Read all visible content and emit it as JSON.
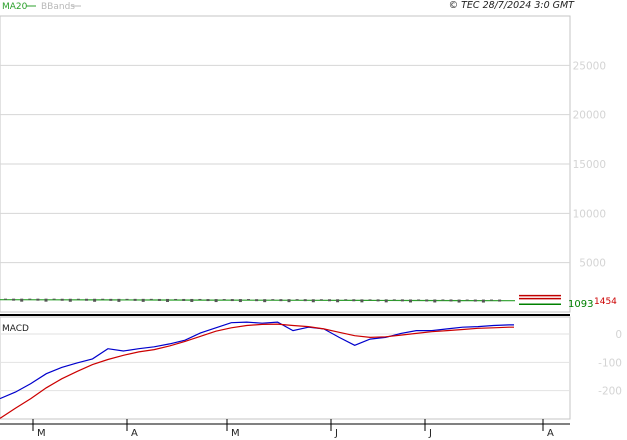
{
  "legend": {
    "ma_label": "MA20",
    "bbands_label": "BBands",
    "ma_color": "#2ca02c",
    "bbands_color": "#b8b8b8"
  },
  "copyright": "© TEC 28/7/2024 3:0 GMT",
  "macd_label": "MACD",
  "price_value_label": "1093",
  "price_value_label2": "1454",
  "chart_data": [
    {
      "type": "line",
      "title": "",
      "yticks": [
        "5000",
        "10000",
        "15000",
        "20000",
        "25000"
      ],
      "ylim": [
        0,
        30000
      ],
      "grid": true,
      "series": [
        {
          "name": "MA20",
          "color": "#2ca02c",
          "x": [
            0,
            10,
            20,
            30,
            40,
            50,
            60,
            70,
            80,
            90,
            100
          ],
          "values": [
            1250,
            1240,
            1230,
            1220,
            1210,
            1200,
            1190,
            1180,
            1170,
            1160,
            1150
          ]
        },
        {
          "color": "#c00000",
          "values": [
            1454
          ]
        },
        {
          "color": "#008000",
          "values": [
            1093
          ]
        }
      ]
    },
    {
      "type": "line",
      "title": "MACD",
      "yticks": [
        "-200",
        "-100",
        "0"
      ],
      "ylim": [
        -300,
        60
      ],
      "grid": true,
      "x_labels": [
        "M",
        "A",
        "M",
        "J",
        "J",
        "A"
      ],
      "series": [
        {
          "color": "#0000cc",
          "x": [
            0,
            3,
            6,
            9,
            12,
            15,
            18,
            21,
            24,
            27,
            30,
            33,
            36,
            39,
            42,
            45,
            48,
            51,
            54,
            57,
            60,
            63,
            66,
            69,
            72,
            75,
            78,
            81,
            84,
            87,
            90,
            93,
            96,
            99,
            100
          ],
          "values": [
            -228,
            -205,
            -175,
            -140,
            -118,
            -102,
            -88,
            -52,
            -60,
            -52,
            -45,
            -35,
            -22,
            4,
            22,
            40,
            42,
            38,
            42,
            12,
            24,
            18,
            -12,
            -40,
            -18,
            -12,
            2,
            12,
            12,
            18,
            24,
            26,
            30,
            32,
            32
          ]
        },
        {
          "color": "#cc0000",
          "x": [
            0,
            3,
            6,
            9,
            12,
            15,
            18,
            21,
            24,
            27,
            30,
            33,
            36,
            39,
            42,
            45,
            48,
            51,
            54,
            57,
            60,
            63,
            66,
            69,
            72,
            75,
            78,
            81,
            84,
            87,
            90,
            93,
            96,
            99,
            100
          ],
          "values": [
            -298,
            -262,
            -228,
            -190,
            -158,
            -132,
            -108,
            -90,
            -75,
            -63,
            -55,
            -42,
            -26,
            -8,
            10,
            22,
            30,
            34,
            35,
            30,
            26,
            18,
            6,
            -6,
            -12,
            -10,
            -4,
            2,
            8,
            12,
            16,
            20,
            22,
            24,
            24
          ]
        }
      ]
    }
  ]
}
